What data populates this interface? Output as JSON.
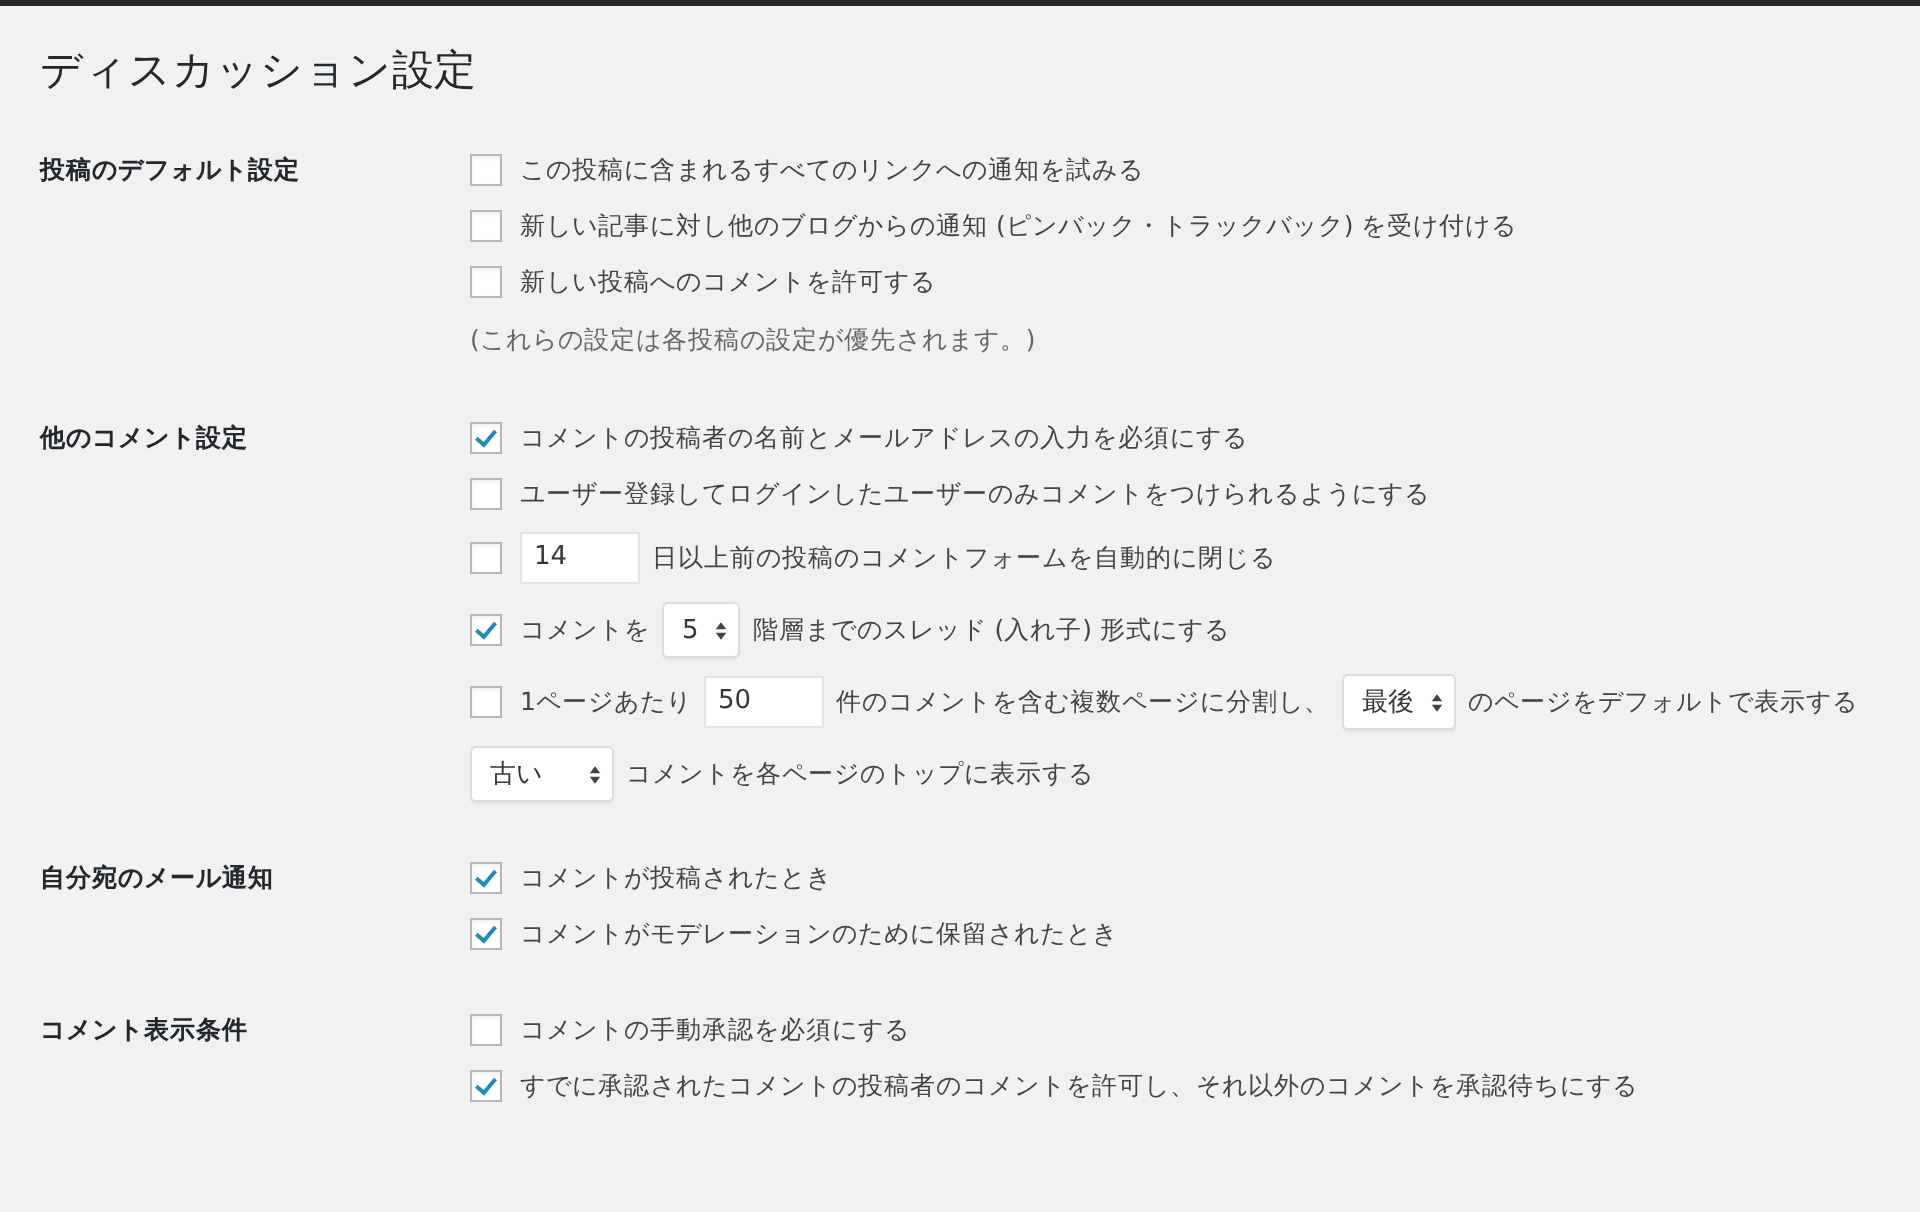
{
  "page_title": "ディスカッション設定",
  "sections": [
    {
      "label": "投稿のデフォルト設定",
      "rows": [
        {
          "kind": "check",
          "checked": false,
          "parts": [
            {
              "kind": "text",
              "text": "この投稿に含まれるすべてのリンクへの通知を試みる"
            }
          ]
        },
        {
          "kind": "check",
          "checked": false,
          "parts": [
            {
              "kind": "text",
              "text": "新しい記事に対し他のブログからの通知 (ピンバック・トラックバック) を受け付ける"
            }
          ]
        },
        {
          "kind": "check",
          "checked": false,
          "parts": [
            {
              "kind": "text",
              "text": "新しい投稿へのコメントを許可する"
            }
          ]
        },
        {
          "kind": "note",
          "parts": [
            {
              "kind": "text",
              "text": "(これらの設定は各投稿の設定が優先されます。)"
            }
          ]
        }
      ]
    },
    {
      "label": "他のコメント設定",
      "rows": [
        {
          "kind": "check",
          "checked": true,
          "parts": [
            {
              "kind": "text",
              "text": "コメントの投稿者の名前とメールアドレスの入力を必須にする"
            }
          ]
        },
        {
          "kind": "check",
          "checked": false,
          "parts": [
            {
              "kind": "text",
              "text": "ユーザー登録してログインしたユーザーのみコメントをつけられるようにする"
            }
          ]
        },
        {
          "kind": "check",
          "checked": false,
          "parts": [
            {
              "kind": "input",
              "value": "14"
            },
            {
              "kind": "text",
              "text": "日以上前の投稿のコメントフォームを自動的に閉じる"
            }
          ]
        },
        {
          "kind": "check",
          "checked": true,
          "parts": [
            {
              "kind": "text",
              "text": "コメントを"
            },
            {
              "kind": "select",
              "value": "5"
            },
            {
              "kind": "text",
              "text": "階層までのスレッド (入れ子) 形式にする"
            }
          ]
        },
        {
          "kind": "check",
          "checked": false,
          "parts": [
            {
              "kind": "text",
              "text": "1ページあたり"
            },
            {
              "kind": "input",
              "value": "50"
            },
            {
              "kind": "text",
              "text": "件のコメントを含む複数ページに分割し、"
            },
            {
              "kind": "select",
              "value": "最後"
            },
            {
              "kind": "text",
              "text": "のページをデフォルトで表示する"
            }
          ]
        },
        {
          "kind": "plain",
          "parts": [
            {
              "kind": "select",
              "value": "古い"
            },
            {
              "kind": "text",
              "text": "コメントを各ページのトップに表示する"
            }
          ]
        }
      ]
    },
    {
      "label": "自分宛のメール通知",
      "rows": [
        {
          "kind": "check",
          "checked": true,
          "parts": [
            {
              "kind": "text",
              "text": "コメントが投稿されたとき"
            }
          ]
        },
        {
          "kind": "check",
          "checked": true,
          "parts": [
            {
              "kind": "text",
              "text": "コメントがモデレーションのために保留されたとき"
            }
          ]
        }
      ]
    },
    {
      "label": "コメント表示条件",
      "rows": [
        {
          "kind": "check",
          "checked": false,
          "parts": [
            {
              "kind": "text",
              "text": "コメントの手動承認を必須にする"
            }
          ]
        },
        {
          "kind": "check",
          "checked": true,
          "parts": [
            {
              "kind": "text",
              "text": "すでに承認されたコメントの投稿者のコメントを許可し、それ以外のコメントを承認待ちにする"
            }
          ]
        }
      ]
    }
  ]
}
